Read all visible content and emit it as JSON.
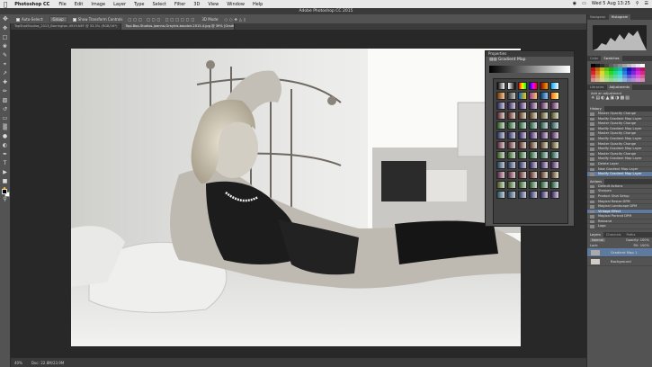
{
  "menubar": {
    "app_name": "Photoshop CC",
    "items": [
      "File",
      "Edit",
      "Image",
      "Layer",
      "Type",
      "Select",
      "Filter",
      "3D",
      "View",
      "Window",
      "Help"
    ],
    "clock": "Wed 5 Aug 13:25"
  },
  "window_title": "Adobe Photoshop CC 2015",
  "options_bar": {
    "auto_select": "Auto-Select:",
    "auto_select_value": "Group",
    "show_transform": "Show Transform Controls",
    "mode_3d": "3D Mode:"
  },
  "tabs": [
    {
      "label": "TopShotStudios_2013_Barrington-4919.NEF @ 33.3% (RGB/16*)",
      "active": false
    },
    {
      "label": "Topi-Boo-Studios-Joanna-Grayiris-boudoir-2015-4.jpg @ 39% (Gradient Map 1, Layer Mask/8) *",
      "active": true
    }
  ],
  "status": {
    "zoom": "40%",
    "doc": "Doc: 22.8M/23.9M"
  },
  "properties": {
    "header": "Properties",
    "title": "Gradient Map"
  },
  "right_panels": {
    "top_tabs": [
      "Navigator",
      "Histogram"
    ],
    "swatch_tabs": [
      "Color",
      "Swatches"
    ],
    "lib_tabs": [
      "Libraries",
      "Adjustments"
    ],
    "add_adjustment": "Add an adjustment",
    "history_tab": "History",
    "history": [
      "Master Opacity Change",
      "Modify Gradient Map Layer",
      "Master Opacity Change",
      "Modify Gradient Map Layer",
      "Master Opacity Change",
      "Modify Gradient Map Layer",
      "Master Opacity Change",
      "Modify Gradient Map Layer",
      "Master Opacity Change",
      "Modify Gradient Map Layer",
      "Delete Layer",
      "New Gradient Map Layer",
      "Modify Gradient Map Layer"
    ],
    "actions_tab": "Actions",
    "actions": [
      "Default Actions",
      "Sharpen",
      "Product Shot Setup",
      "Magical Resize DPM",
      "Magical Landscape DPM",
      "Vintage Effect",
      "Magical Portrait DPM",
      "Rebrand",
      "Logo"
    ],
    "layers_tabs": [
      "Layers",
      "Channels",
      "Paths"
    ],
    "blend_mode": "Normal",
    "opacity_label": "Opacity:",
    "opacity_value": "100%",
    "fill_label": "Fill:",
    "fill_value": "100%",
    "lock_label": "Lock:",
    "layers": [
      {
        "name": "Gradient Map 1",
        "selected": true
      },
      {
        "name": "Background",
        "selected": false
      }
    ]
  },
  "colors": {
    "accent": "#5e7a9e"
  }
}
